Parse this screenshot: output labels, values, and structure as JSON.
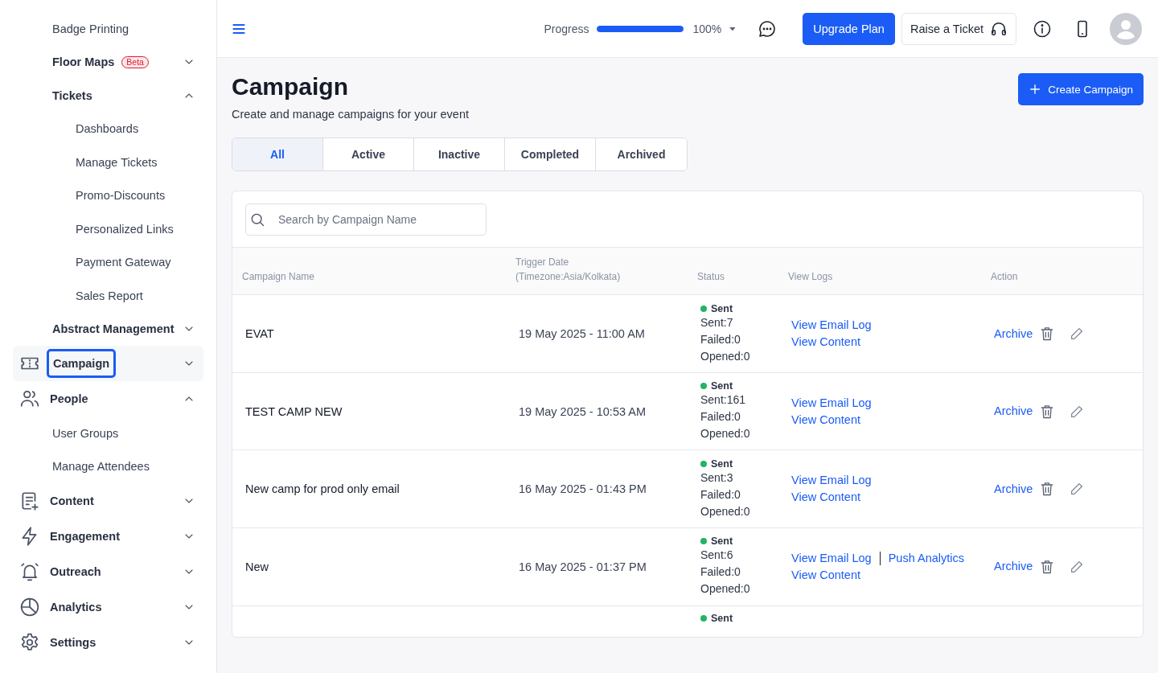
{
  "sidebar": {
    "sub_items": [
      {
        "label": "Badge Printing"
      },
      {
        "label": "Floor Maps",
        "badge": "Beta",
        "expanded": false
      },
      {
        "label": "Tickets",
        "expanded": true,
        "children": [
          {
            "label": "Dashboards"
          },
          {
            "label": "Manage Tickets"
          },
          {
            "label": "Promo-Discounts"
          },
          {
            "label": "Personalized Links"
          },
          {
            "label": "Payment Gateway"
          },
          {
            "label": "Sales Report"
          }
        ]
      },
      {
        "label": "Abstract Management",
        "expanded": false
      }
    ],
    "items": [
      {
        "label": "Campaign",
        "kind": "ticket",
        "selected": true,
        "expanded": false
      },
      {
        "label": "People",
        "kind": "people",
        "selected": false,
        "expanded": true,
        "children": [
          {
            "label": "User Groups"
          },
          {
            "label": "Manage Attendees"
          }
        ]
      },
      {
        "label": "Content",
        "kind": "document",
        "selected": false,
        "expanded": false
      },
      {
        "label": "Engagement",
        "kind": "bolt",
        "selected": false,
        "expanded": false
      },
      {
        "label": "Outreach",
        "kind": "bell",
        "selected": false,
        "expanded": false
      },
      {
        "label": "Analytics",
        "kind": "pie",
        "selected": false,
        "expanded": false
      },
      {
        "label": "Settings",
        "kind": "gear",
        "selected": false,
        "expanded": false
      }
    ]
  },
  "header": {
    "progress": {
      "label": "Progress",
      "level": 1,
      "reading": "100%"
    },
    "upgrade_button": "Upgrade Plan",
    "ticket_button": "Raise a Ticket"
  },
  "page": {
    "title": "Campaign",
    "subtitle": "Create and manage campaigns for your event",
    "create_button": "Create Campaign"
  },
  "tabs": [
    {
      "label": "All",
      "selected": true
    },
    {
      "label": "Active",
      "selected": false
    },
    {
      "label": "Inactive",
      "selected": false
    },
    {
      "label": "Completed",
      "selected": false
    },
    {
      "label": "Archived",
      "selected": false
    }
  ],
  "search": {
    "placeholder": "Search by Campaign Name"
  },
  "table": {
    "columns": [
      "Campaign Name",
      "Trigger Date\n(Timezone:Asia/Kolkata)",
      "Status",
      "View Logs",
      "Action"
    ],
    "rows": [
      {
        "name": "EVAT",
        "date": "19 May 2025 - 11:00 AM",
        "status": {
          "label": "Sent",
          "color": "#22b464"
        },
        "counts": [
          "Sent:7",
          "Failed:0",
          "Opened:0"
        ],
        "email_log": "View Email Log",
        "content_link": "View Content",
        "archive": "Archive"
      },
      {
        "name": "TEST CAMP NEW",
        "date": "19 May 2025 - 10:53 AM",
        "status": {
          "label": "Sent",
          "color": "#22b464"
        },
        "counts": [
          "Sent:161",
          "Failed:0",
          "Opened:0"
        ],
        "email_log": "View Email Log",
        "content_link": "View Content",
        "archive": "Archive"
      },
      {
        "name": "New camp for prod only email",
        "date": "16 May 2025 - 01:43 PM",
        "status": {
          "label": "Sent",
          "color": "#22b464"
        },
        "counts": [
          "Sent:3",
          "Failed:0",
          "Opened:0"
        ],
        "email_log": "View Email Log",
        "content_link": "View Content",
        "archive": "Archive"
      },
      {
        "name": "New",
        "date": "16 May 2025 - 01:37 PM",
        "status": {
          "label": "Sent",
          "color": "#22b464"
        },
        "counts": [
          "Sent:6",
          "Failed:0",
          "Opened:0"
        ],
        "email_log": "View Email Log",
        "push_analytics": "Push Analytics",
        "content_link": "View Content",
        "archive": "Archive"
      },
      {
        "status": {
          "label": "Sent",
          "color": "#22b464"
        }
      }
    ]
  }
}
